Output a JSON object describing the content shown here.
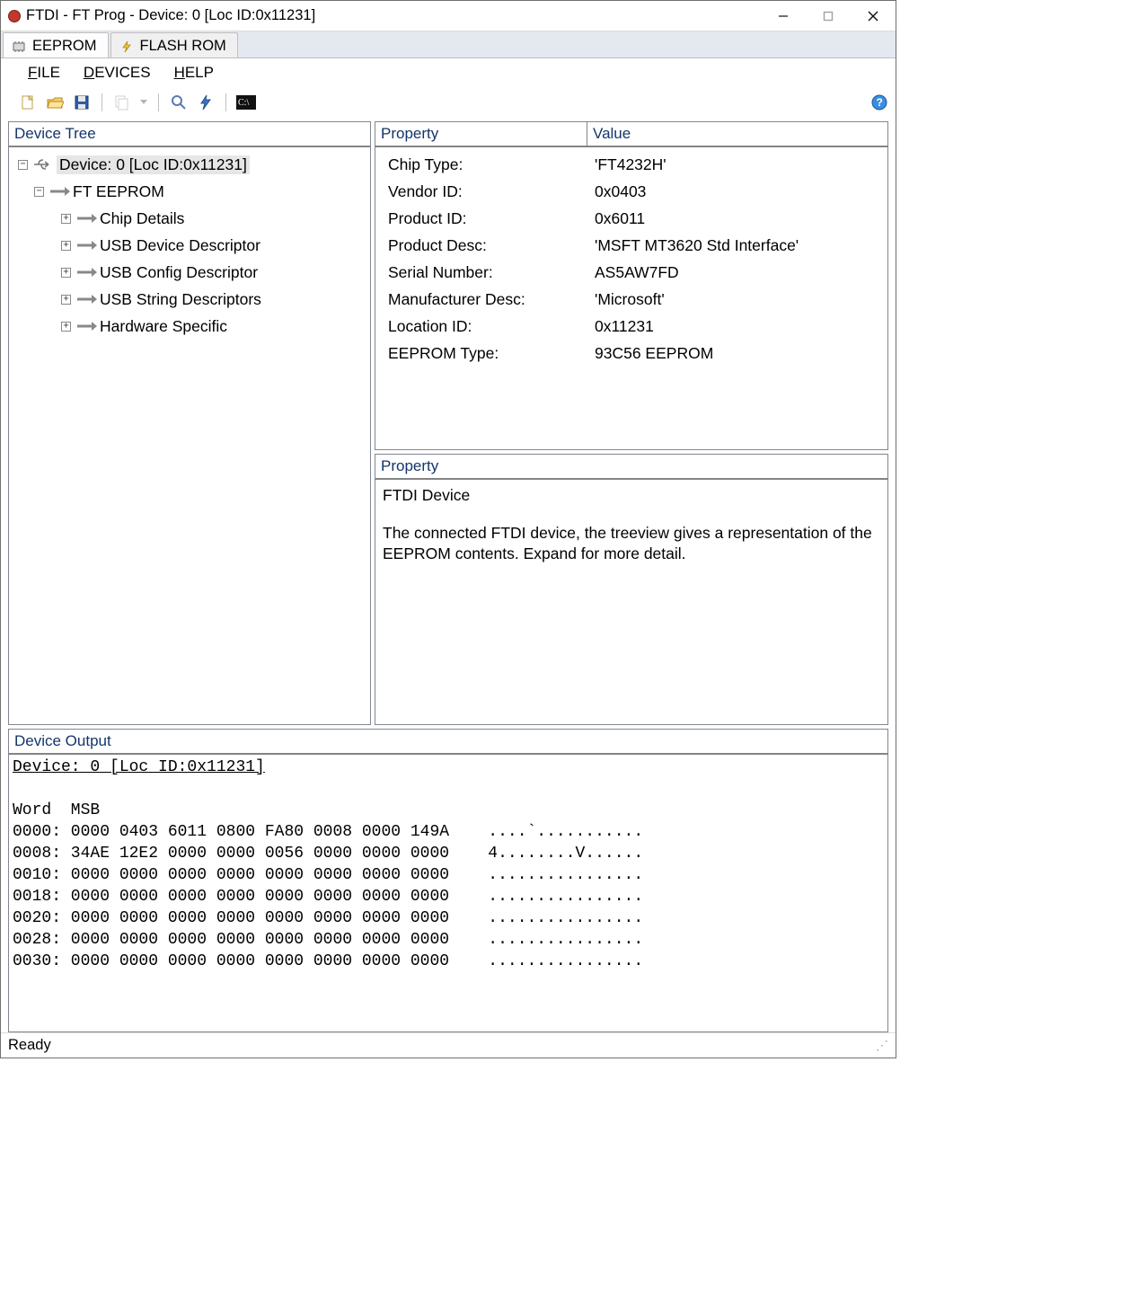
{
  "window": {
    "title": "FTDI - FT Prog - Device: 0 [Loc ID:0x11231]"
  },
  "tabs": [
    {
      "label": "EEPROM",
      "active": true
    },
    {
      "label": "FLASH ROM",
      "active": false
    }
  ],
  "menu": {
    "file": "FILE",
    "devices": "DEVICES",
    "help": "HELP"
  },
  "panelHeaders": {
    "deviceTree": "Device Tree",
    "property": "Property",
    "value": "Value",
    "deviceOutput": "Device Output"
  },
  "tree": {
    "root": "Device: 0 [Loc ID:0x11231]",
    "ftEeprom": "FT EEPROM",
    "children": [
      "Chip Details",
      "USB Device Descriptor",
      "USB Config Descriptor",
      "USB String Descriptors",
      "Hardware Specific"
    ]
  },
  "properties": [
    {
      "label": "Chip Type:",
      "value": "'FT4232H'"
    },
    {
      "label": "Vendor ID:",
      "value": "0x0403"
    },
    {
      "label": "Product ID:",
      "value": "0x6011"
    },
    {
      "label": "Product Desc:",
      "value": "'MSFT MT3620 Std Interface'"
    },
    {
      "label": "Serial Number:",
      "value": "AS5AW7FD"
    },
    {
      "label": "Manufacturer Desc:",
      "value": "'Microsoft'"
    },
    {
      "label": "Location ID:",
      "value": "0x11231"
    },
    {
      "label": "EEPROM Type:",
      "value": "93C56 EEPROM"
    }
  ],
  "helpBox": {
    "header": "Property",
    "title": "FTDI Device",
    "text": "The connected FTDI device, the treeview gives a representation of the EEPROM contents.  Expand for more detail."
  },
  "output": {
    "titleLine": "Device: 0 [Loc ID:0x11231]",
    "blankLine": "",
    "header": "Word  MSB",
    "rows": [
      "0000: 0000 0403 6011 0800 FA80 0008 0000 149A    ....`...........",
      "0008: 34AE 12E2 0000 0000 0056 0000 0000 0000    4........V......",
      "0010: 0000 0000 0000 0000 0000 0000 0000 0000    ................",
      "0018: 0000 0000 0000 0000 0000 0000 0000 0000    ................",
      "0020: 0000 0000 0000 0000 0000 0000 0000 0000    ................",
      "0028: 0000 0000 0000 0000 0000 0000 0000 0000    ................",
      "0030: 0000 0000 0000 0000 0000 0000 0000 0000    ................"
    ]
  },
  "status": {
    "text": "Ready"
  }
}
